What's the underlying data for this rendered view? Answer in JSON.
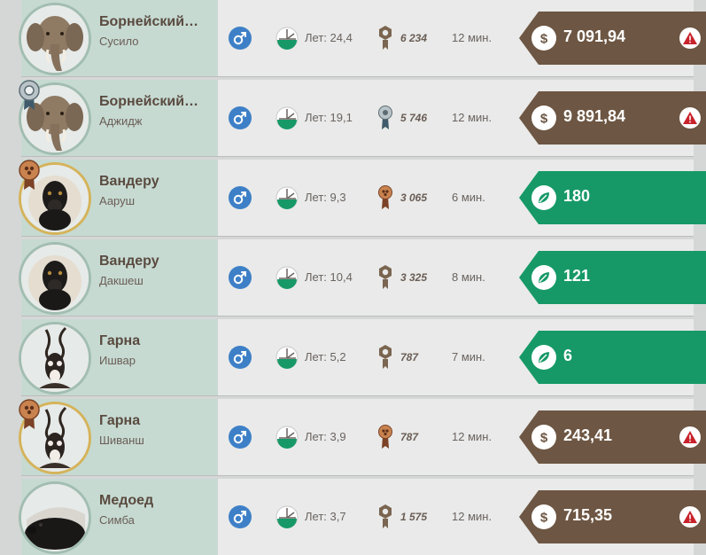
{
  "colors": {
    "money": "#6d5643",
    "leaf": "#169967",
    "gender": "#3e80c7",
    "warning": "#c8232c"
  },
  "animals": [
    {
      "name": "Борнейский…",
      "nickname": "Сусило",
      "species_icon": "elephant-icon",
      "gender": "male-icon",
      "age": "Лет: 24,4",
      "score_icon": "hex-badge-icon",
      "score": "6 234",
      "time": "12 мин.",
      "price_type": "money",
      "price": "7 091,94",
      "warning": true,
      "medal": ""
    },
    {
      "name": "Борнейский…",
      "nickname": "Аджидж",
      "species_icon": "elephant-icon",
      "gender": "male-icon",
      "age": "Лет: 19,1",
      "score_icon": "silver-medal-icon",
      "score": "5 746",
      "time": "12 мин.",
      "price_type": "money",
      "price": "9 891,84",
      "warning": true,
      "medal": "silver"
    },
    {
      "name": "Вандеру",
      "nickname": "Ааруш",
      "species_icon": "monkey-icon",
      "gender": "male-icon",
      "age": "Лет: 9,3",
      "score_icon": "bronze-medal-icon",
      "score": "3 065",
      "time": "6 мин.",
      "price_type": "leaf",
      "price": "180",
      "warning": false,
      "medal": "bronze"
    },
    {
      "name": "Вандеру",
      "nickname": "Дакшеш",
      "species_icon": "monkey-icon",
      "gender": "male-icon",
      "age": "Лет: 10,4",
      "score_icon": "hex-badge-icon",
      "score": "3 325",
      "time": "8 мин.",
      "price_type": "leaf",
      "price": "121",
      "warning": false,
      "medal": ""
    },
    {
      "name": "Гарна",
      "nickname": "Ишвар",
      "species_icon": "antelope-icon",
      "gender": "male-icon",
      "age": "Лет: 5,2",
      "score_icon": "hex-badge-icon",
      "score": "787",
      "time": "7 мин.",
      "price_type": "leaf",
      "price": "6",
      "warning": false,
      "medal": ""
    },
    {
      "name": "Гарна",
      "nickname": "Шиванш",
      "species_icon": "antelope-icon",
      "gender": "male-icon",
      "age": "Лет: 3,9",
      "score_icon": "bronze-medal-icon",
      "score": "787",
      "time": "12 мин.",
      "price_type": "money",
      "price": "243,41",
      "warning": true,
      "medal": "bronze"
    },
    {
      "name": "Медоед",
      "nickname": "Симба",
      "species_icon": "honey-badger-icon",
      "gender": "male-icon",
      "age": "Лет: 3,7",
      "score_icon": "hex-badge-icon",
      "score": "1 575",
      "time": "12 мин.",
      "price_type": "money",
      "price": "715,35",
      "warning": true,
      "medal": ""
    }
  ]
}
